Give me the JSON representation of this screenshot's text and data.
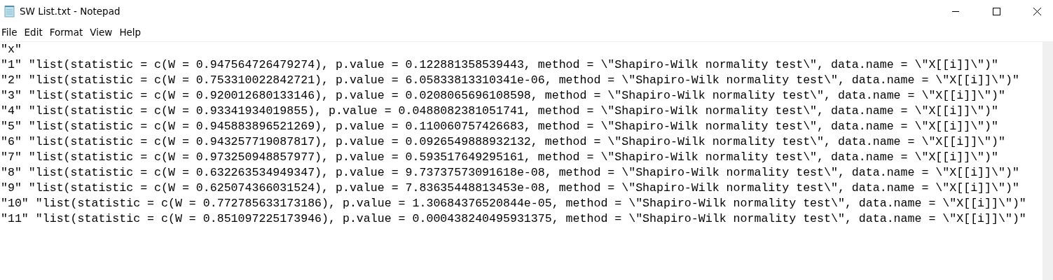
{
  "window": {
    "title": "SW List.txt - Notepad"
  },
  "menu": [
    "File",
    "Edit",
    "Format",
    "View",
    "Help"
  ],
  "lines": [
    "\"x\"",
    "\"1\" \"list(statistic = c(W = 0.947564726479274), p.value = 0.122881358539443, method = \\\"Shapiro-Wilk normality test\\\", data.name = \\\"X[[i]]\\\")\"",
    "\"2\" \"list(statistic = c(W = 0.753310022842721), p.value = 6.05833813310341e-06, method = \\\"Shapiro-Wilk normality test\\\", data.name = \\\"X[[i]]\\\")\"",
    "\"3\" \"list(statistic = c(W = 0.920012680133146), p.value = 0.0208065696108598, method = \\\"Shapiro-Wilk normality test\\\", data.name = \\\"X[[i]]\\\")\"",
    "\"4\" \"list(statistic = c(W = 0.93341934019855), p.value = 0.0488082381051741, method = \\\"Shapiro-Wilk normality test\\\", data.name = \\\"X[[i]]\\\")\"",
    "\"5\" \"list(statistic = c(W = 0.945883896521269), p.value = 0.110060757426683, method = \\\"Shapiro-Wilk normality test\\\", data.name = \\\"X[[i]]\\\")\"",
    "\"6\" \"list(statistic = c(W = 0.943257719087817), p.value = 0.0926549888932132, method = \\\"Shapiro-Wilk normality test\\\", data.name = \\\"X[[i]]\\\")\"",
    "\"7\" \"list(statistic = c(W = 0.973250948857977), p.value = 0.593517649295161, method = \\\"Shapiro-Wilk normality test\\\", data.name = \\\"X[[i]]\\\")\"",
    "\"8\" \"list(statistic = c(W = 0.632263534949347), p.value = 9.73737573091618e-08, method = \\\"Shapiro-Wilk normality test\\\", data.name = \\\"X[[i]]\\\")\"",
    "\"9\" \"list(statistic = c(W = 0.625074366031524), p.value = 7.83635448813453e-08, method = \\\"Shapiro-Wilk normality test\\\", data.name = \\\"X[[i]]\\\")\"",
    "\"10\" \"list(statistic = c(W = 0.772785633173186), p.value = 1.30684376520844e-05, method = \\\"Shapiro-Wilk normality test\\\", data.name = \\\"X[[i]]\\\")\"",
    "\"11\" \"list(statistic = c(W = 0.851097225173946), p.value = 0.000438240495931375, method = \\\"Shapiro-Wilk normality test\\\", data.name = \\\"X[[i]]\\\")\""
  ]
}
